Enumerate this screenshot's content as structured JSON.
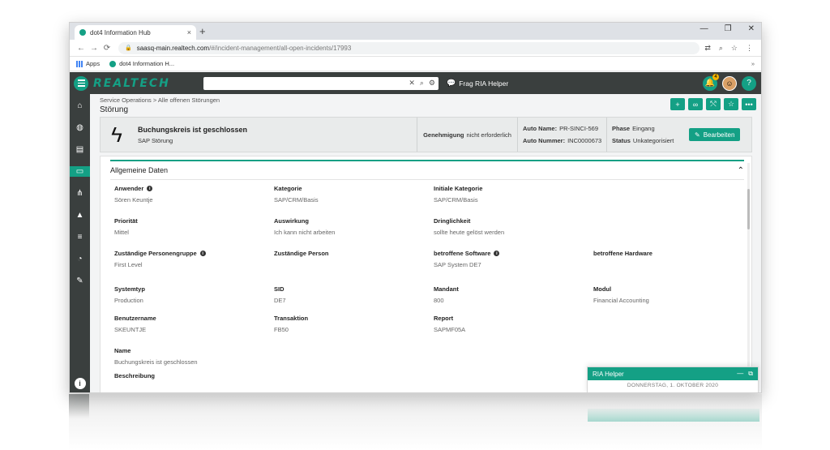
{
  "browser": {
    "tab_title": "dot4 Information Hub",
    "tab_close": "×",
    "new_tab": "+",
    "win_min": "—",
    "win_max": "❐",
    "win_close": "✕",
    "url_host": "saasq-main.realtech.com",
    "url_path": "/#/incident-management/all-open-incidents/17993",
    "bookmarks": [
      "Apps",
      "dot4 Information H..."
    ],
    "bookmarks_more": "»"
  },
  "app": {
    "logo": "REALTECH",
    "search_clear": "✕",
    "ria_link": "Frag RIA Helper",
    "notification_count": "4"
  },
  "page": {
    "breadcrumb": "Service Operations > Alle offenen Störungen",
    "title": "Störung"
  },
  "incident": {
    "title": "Buchungskreis ist geschlossen",
    "subtitle": "SAP Störung",
    "approval_label": "Genehmigung",
    "approval_value": "nicht erforderlich",
    "auto_name_label": "Auto Name:",
    "auto_name_value": "PR-SINCI-569",
    "auto_number_label": "Auto Nummer:",
    "auto_number_value": "INC0000673",
    "phase_label": "Phase",
    "phase_value": "Eingang",
    "status_label": "Status",
    "status_value": "Unkategorisiert",
    "edit_label": "Bearbeiten"
  },
  "panel": {
    "title": "Allgemeine Daten",
    "fields": {
      "anwender": {
        "label": "Anwender",
        "value": "Sören Keuntje"
      },
      "kategorie": {
        "label": "Kategorie",
        "value": "SAP/CRM/Basis"
      },
      "initiale_kategorie": {
        "label": "Initiale Kategorie",
        "value": "SAP/CRM/Basis"
      },
      "prioritaet": {
        "label": "Priorität",
        "value": "Mittel"
      },
      "auswirkung": {
        "label": "Auswirkung",
        "value": "Ich kann nicht arbeiten"
      },
      "dringlichkeit": {
        "label": "Dringlichkeit",
        "value": "sollte heute gelöst werden"
      },
      "personengruppe": {
        "label": "Zuständige Personengruppe",
        "value": "First Level"
      },
      "person": {
        "label": "Zuständige Person",
        "value": ""
      },
      "software": {
        "label": "betroffene Software",
        "value": "SAP System DE7"
      },
      "hardware": {
        "label": "betroffene Hardware",
        "value": ""
      },
      "systemtyp": {
        "label": "Systemtyp",
        "value": "Production"
      },
      "sid": {
        "label": "SID",
        "value": "DE7"
      },
      "mandant": {
        "label": "Mandant",
        "value": "800"
      },
      "modul": {
        "label": "Modul",
        "value": "Financial Accounting"
      },
      "benutzername": {
        "label": "Benutzername",
        "value": "SKEUNTJE"
      },
      "transaktion": {
        "label": "Transaktion",
        "value": "FB50"
      },
      "report": {
        "label": "Report",
        "value": "SAPMF05A"
      },
      "name": {
        "label": "Name",
        "value": "Buchungskreis ist geschlossen"
      },
      "beschreibung": {
        "label": "Beschreibung",
        "value": ""
      }
    }
  },
  "ria_helper": {
    "title": "RIA Helper",
    "date": "DONNERSTAG, 1. OKTOBER 2020"
  },
  "colors": {
    "accent": "#14a085",
    "dark_header": "#3a3f3e"
  }
}
